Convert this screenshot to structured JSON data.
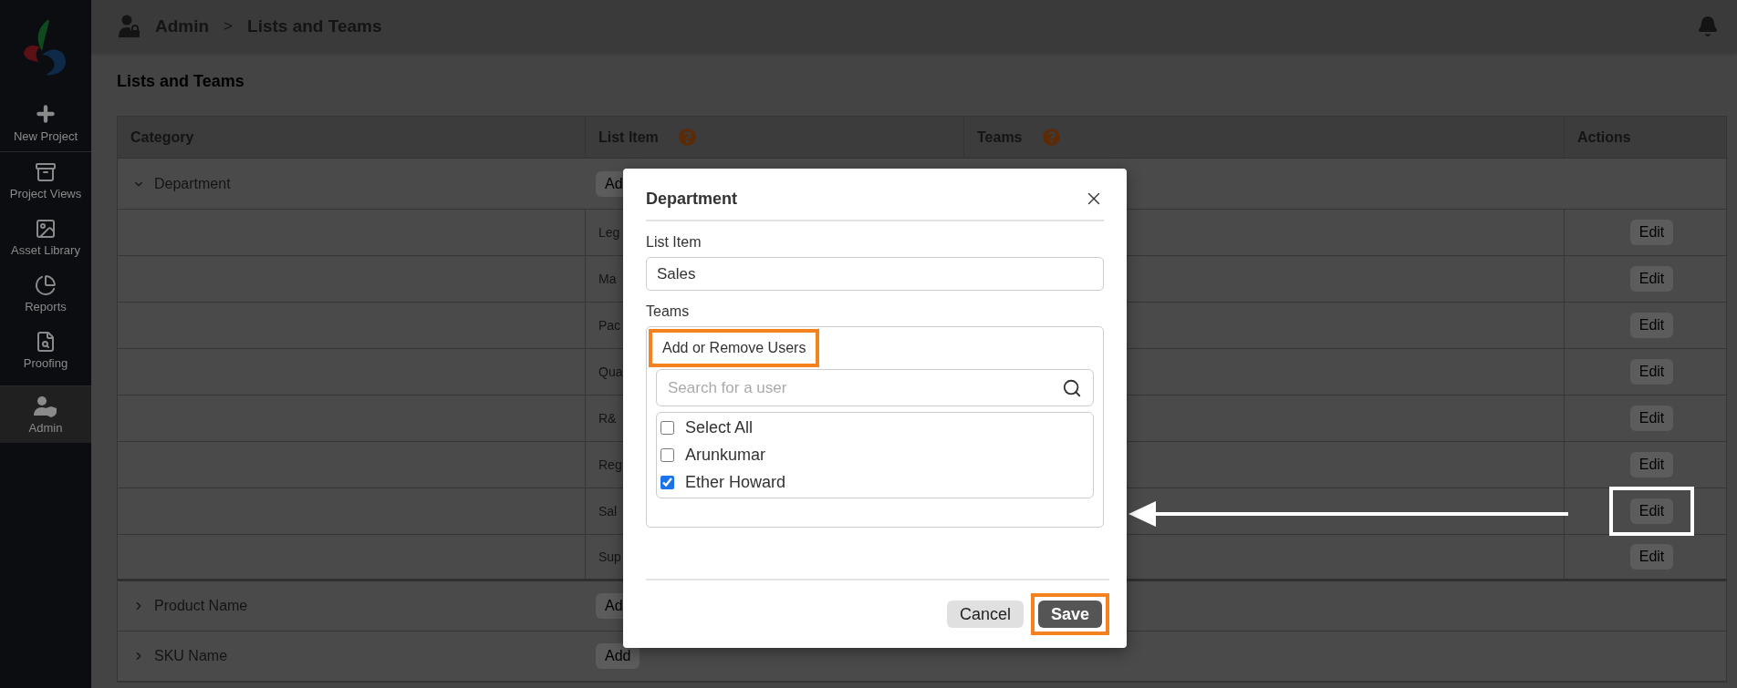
{
  "sidebar": {
    "items": [
      {
        "label": "New Project",
        "selected": false
      },
      {
        "label": "Project Views",
        "selected": false
      },
      {
        "label": "Asset Library",
        "selected": false
      },
      {
        "label": "Reports",
        "selected": false
      },
      {
        "label": "Proofing",
        "selected": false
      },
      {
        "label": "Admin",
        "selected": true
      }
    ]
  },
  "header": {
    "breadcrumb": [
      "Admin",
      "Lists and Teams"
    ],
    "separator": ">"
  },
  "page_title": "Lists and Teams",
  "table": {
    "columns": [
      {
        "label": "Category",
        "help": false
      },
      {
        "label": "List Item",
        "help": true
      },
      {
        "label": "Teams",
        "help": true
      },
      {
        "label": "Actions",
        "help": false
      }
    ],
    "groups": [
      {
        "category": "Department",
        "expanded": true,
        "add_label": "Ad",
        "items": [
          {
            "list_item": "Leg",
            "action": "Edit",
            "highlighted": false
          },
          {
            "list_item": "Ma",
            "action": "Edit",
            "highlighted": false
          },
          {
            "list_item": "Pac",
            "action": "Edit",
            "highlighted": false
          },
          {
            "list_item": "Qua",
            "action": "Edit",
            "highlighted": false
          },
          {
            "list_item": "R&",
            "action": "Edit",
            "highlighted": false
          },
          {
            "list_item": "Reg",
            "action": "Edit",
            "highlighted": false
          },
          {
            "list_item": "Sal",
            "action": "Edit",
            "highlighted": true
          },
          {
            "list_item": "Sup",
            "action": "Edit",
            "highlighted": false
          }
        ]
      },
      {
        "category": "Product Name",
        "expanded": false,
        "add_label": "Ad"
      },
      {
        "category": "SKU Name",
        "expanded": false,
        "add_label": "Add"
      }
    ]
  },
  "dialog": {
    "title": "Department",
    "list_item_label": "List Item",
    "list_item_value": "Sales",
    "teams_label": "Teams",
    "users_heading": {
      "text": "Add or Remove Users",
      "highlighted": true
    },
    "search": {
      "placeholder": "Search for a user"
    },
    "users": [
      {
        "name": "Select All",
        "checked": false
      },
      {
        "name": "Arunkumar",
        "checked": false
      },
      {
        "name": "Ether Howard",
        "checked": true
      }
    ],
    "buttons": [
      {
        "label": "Cancel",
        "kind": "secondary",
        "highlighted": false
      },
      {
        "label": "Save",
        "kind": "primary",
        "highlighted": true
      }
    ]
  }
}
